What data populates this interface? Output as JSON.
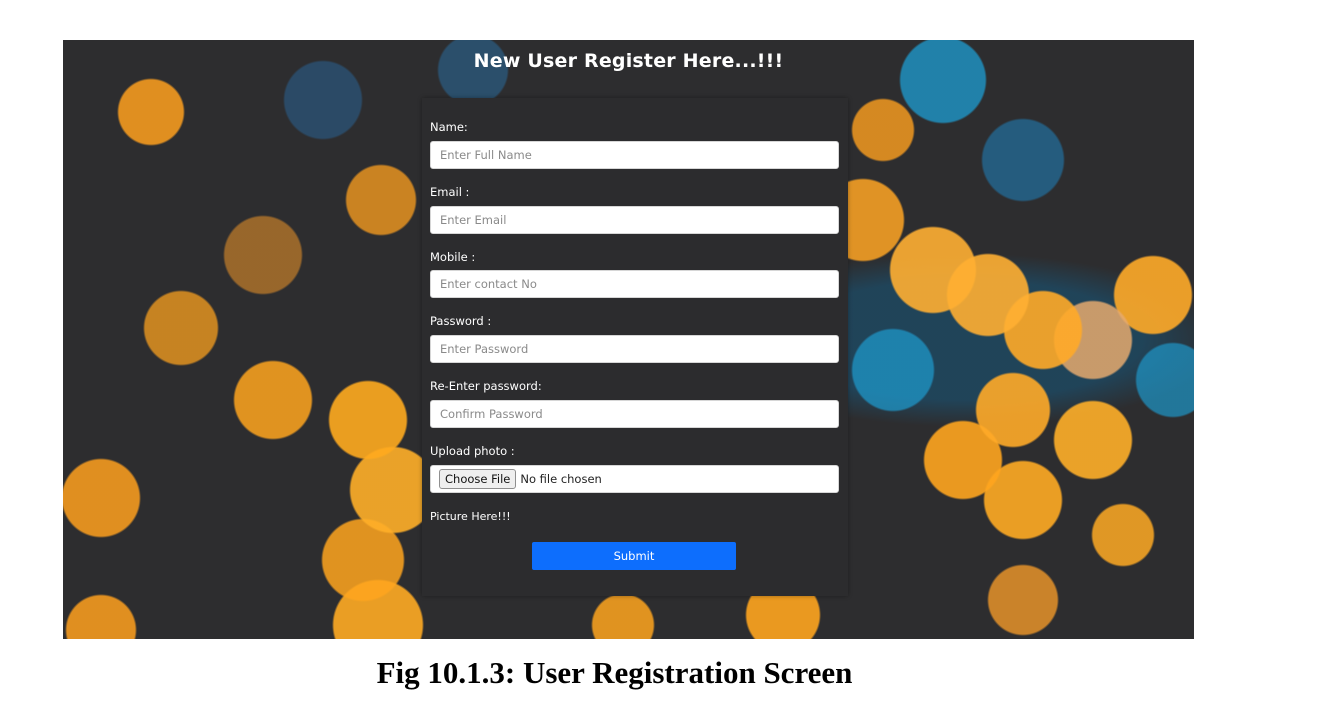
{
  "heading": "New User Register Here...!!!",
  "form": {
    "name": {
      "label": "Name:",
      "placeholder": "Enter Full Name"
    },
    "email": {
      "label": "Email :",
      "placeholder": "Enter Email"
    },
    "mobile": {
      "label": "Mobile :",
      "placeholder": "Enter contact No"
    },
    "password": {
      "label": "Password :",
      "placeholder": "Enter Password"
    },
    "confirm": {
      "label": "Re-Enter password:",
      "placeholder": "Confirm Password"
    },
    "photo": {
      "label": "Upload photo :",
      "button": "Choose File",
      "status": "No file chosen"
    },
    "picture_note": "Picture Here!!!",
    "submit": "Submit"
  },
  "caption": "Fig 10.1.3: User Registration Screen",
  "colors": {
    "submit_button": "#0d6efd",
    "panel": "#2c2c2e",
    "background": "#2d2d2f"
  }
}
